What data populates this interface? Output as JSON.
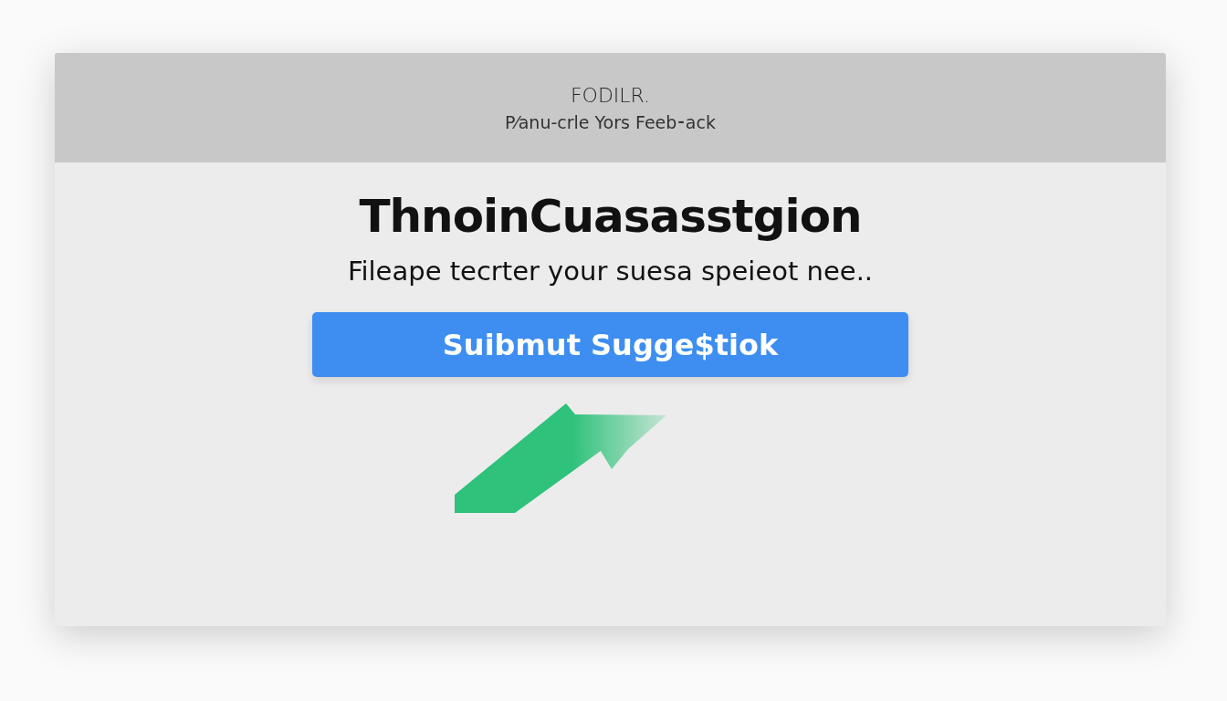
{
  "header": {
    "title": "FODILR.",
    "subtitle": "P⁄anu-crle Yors Feeb⁃ack"
  },
  "heading": "ThnoinCuasasstgion",
  "prompt": "Fileape tecrter your suesa speieot nee..",
  "submit_button": {
    "label": "Suibmut Sugge$tiok"
  }
}
